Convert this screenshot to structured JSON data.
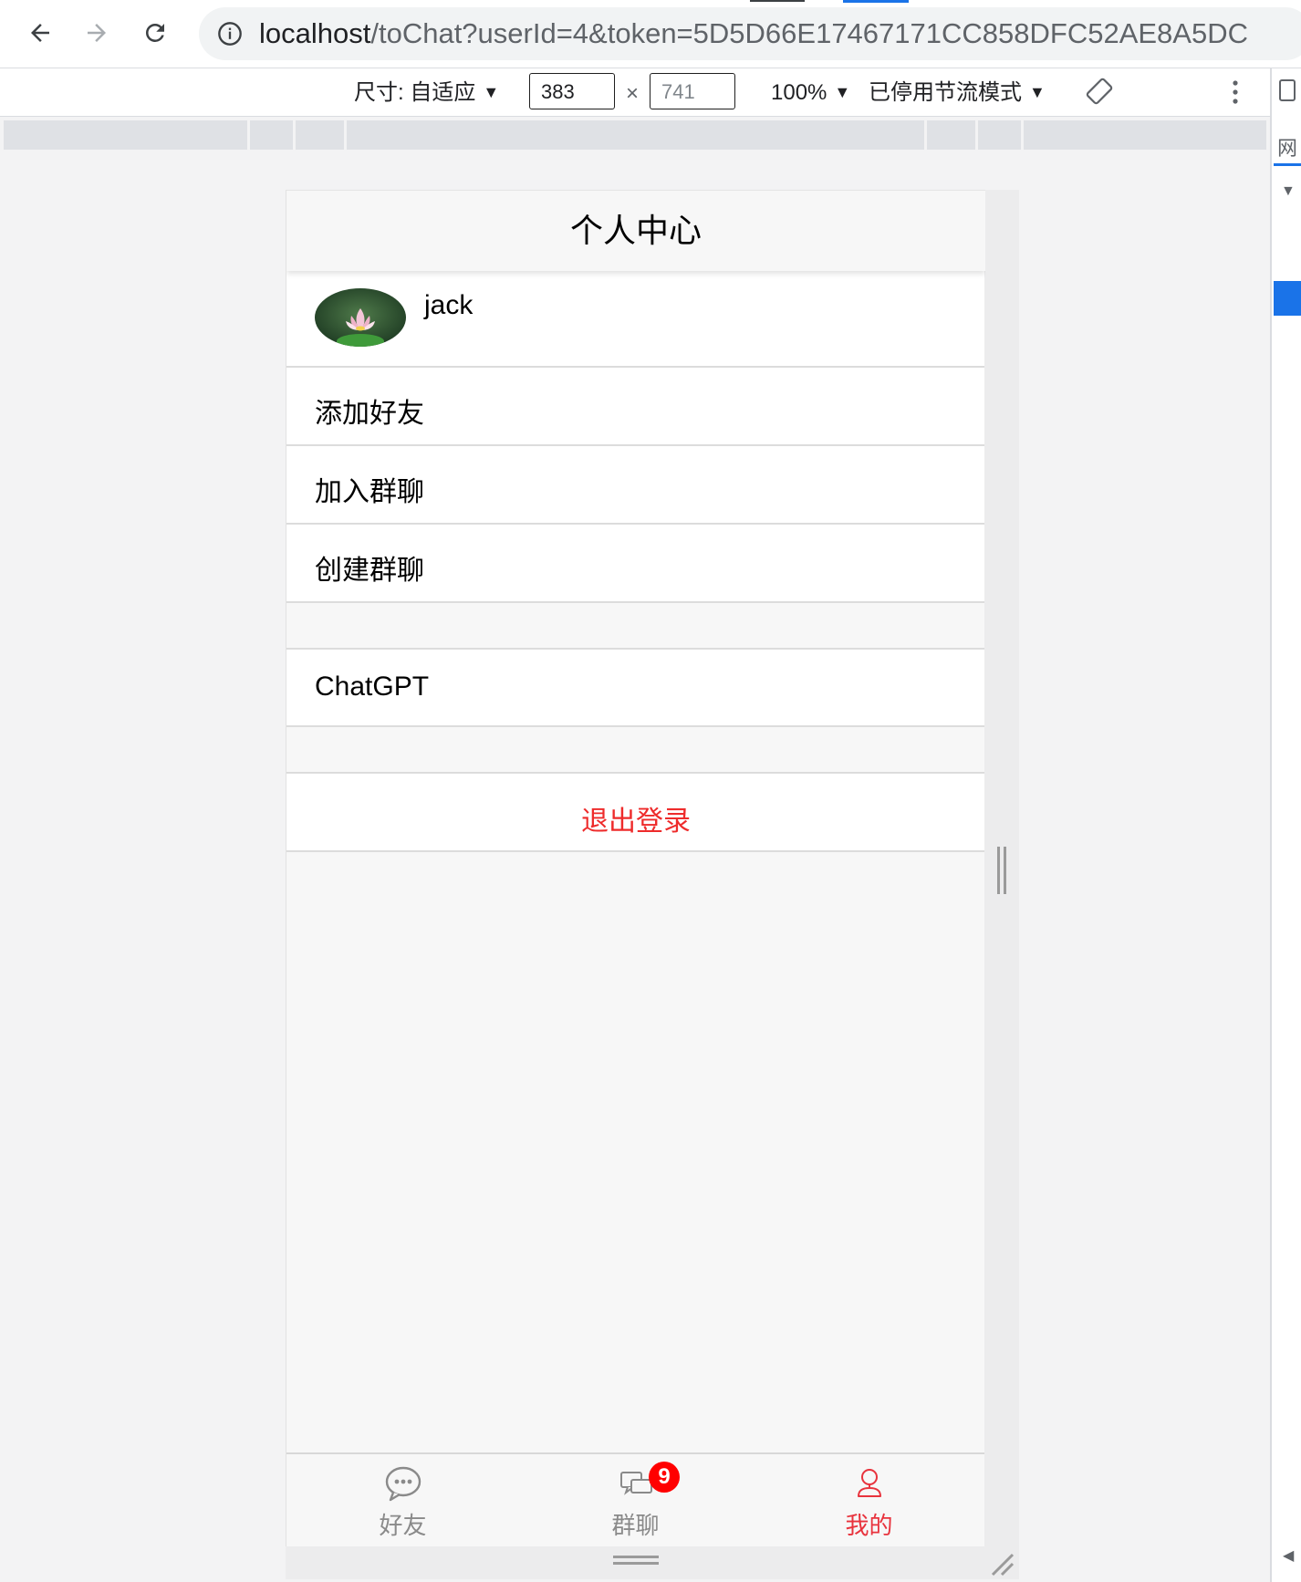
{
  "browser": {
    "url_host": "localhost",
    "url_path": "/toChat?userId=4&token=5D5D66E17467171CC858DFC52AE8A5DC"
  },
  "devtools": {
    "dimensions_label": "尺寸: 自适应",
    "width_value": "383",
    "height_value": "741",
    "times": "×",
    "zoom": "100%",
    "throttle": "已停用节流模式",
    "panel_tab": "网"
  },
  "app": {
    "title": "个人中心",
    "profile": {
      "name": "jack",
      "avatar_icon": "lotus-avatar"
    },
    "menu": {
      "add_friend": "添加好友",
      "join_group": "加入群聊",
      "create_group": "创建群聊",
      "chatgpt": "ChatGPT"
    },
    "logout": "退出登录",
    "tabs": [
      {
        "label": "好友",
        "icon": "chat-bubble-icon",
        "active": false
      },
      {
        "label": "群聊",
        "icon": "group-chat-icon",
        "active": false,
        "badge": "9"
      },
      {
        "label": "我的",
        "icon": "person-icon",
        "active": true
      }
    ]
  },
  "colors": {
    "accent_red": "#ee2b2b",
    "active_tab": "#e8333d",
    "badge": "#ff0000",
    "devtools_blue": "#1a73e8"
  }
}
